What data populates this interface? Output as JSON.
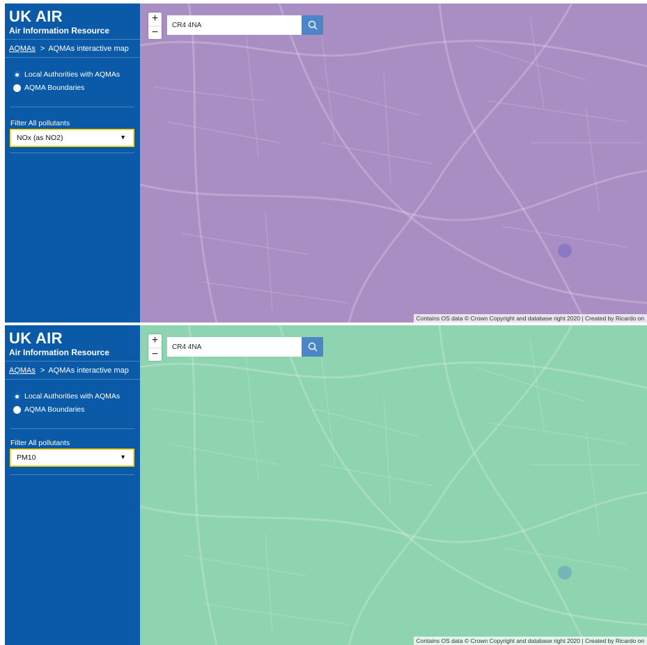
{
  "panels": [
    {
      "brand": {
        "title": "UK AIR",
        "subtitle": "Air Information Resource"
      },
      "breadcrumb": {
        "link": "AQMAs",
        "separator": ">",
        "current": "AQMAs interactive map"
      },
      "layer_options": [
        {
          "label": "Local Authorities with AQMAs",
          "checked": true
        },
        {
          "label": "AQMA Boundaries",
          "checked": false
        }
      ],
      "filter": {
        "label": "Filter All pollutants",
        "selected": "NOx (as NO2)"
      },
      "map": {
        "overlay_color": "#a98ec3",
        "search_value": "CR4 4NA",
        "zoom_in": "+",
        "zoom_out": "−",
        "attribution": "Contains OS data © Crown Copyright and database right 2020 | Created by Ricardo on"
      }
    },
    {
      "brand": {
        "title": "UK AIR",
        "subtitle": "Air Information Resource"
      },
      "breadcrumb": {
        "link": "AQMAs",
        "separator": ">",
        "current": "AQMAs interactive map"
      },
      "layer_options": [
        {
          "label": "Local Authorities with AQMAs",
          "checked": true
        },
        {
          "label": "AQMA Boundaries",
          "checked": false
        }
      ],
      "filter": {
        "label": "Filter All pollutants",
        "selected": "PM10"
      },
      "map": {
        "overlay_color": "#8ed4b0",
        "search_value": "CR4 4NA",
        "zoom_in": "+",
        "zoom_out": "−",
        "attribution": "Contains OS data © Crown Copyright and database right 2020 | Created by Ricardo on"
      }
    }
  ],
  "icons": {
    "search": "search-icon",
    "dropdown": "caret-down-icon"
  },
  "colors": {
    "sidebar": "#0b5aa8",
    "select_border": "#f3d82a",
    "search_button": "#4a86c8"
  }
}
